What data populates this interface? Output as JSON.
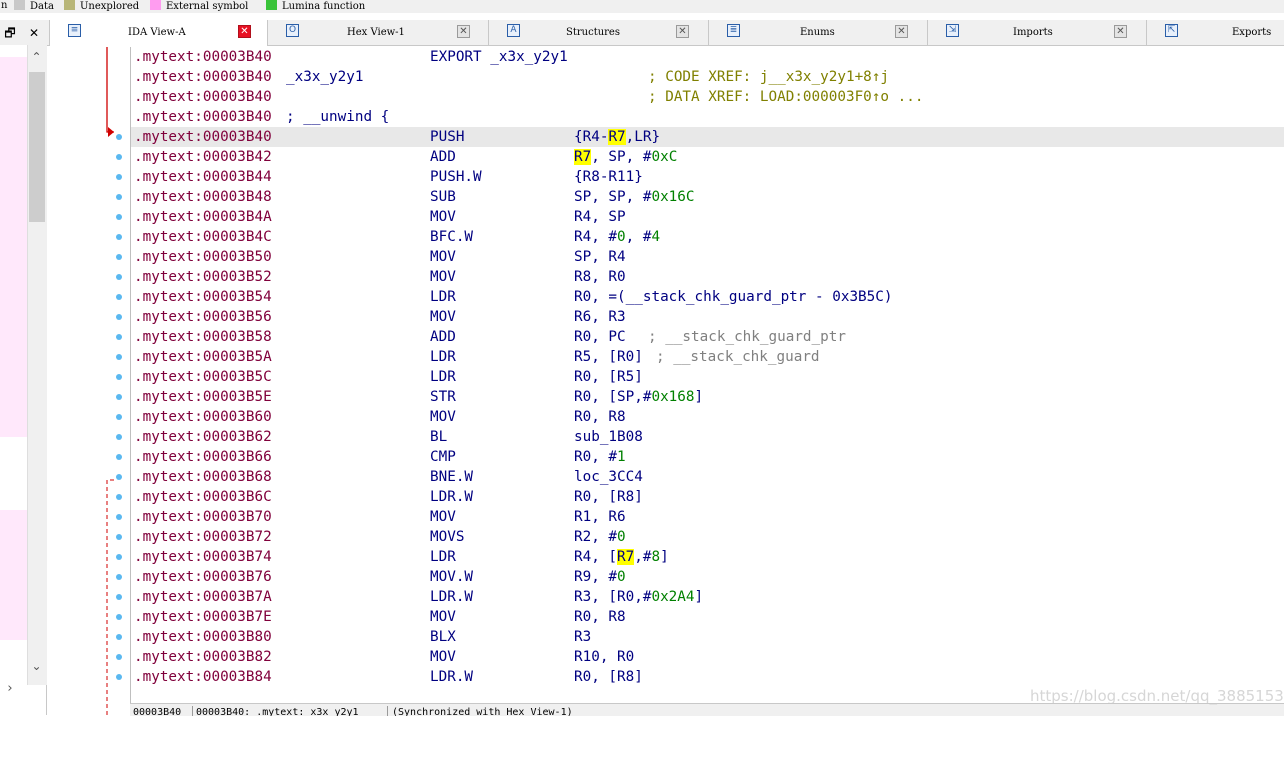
{
  "legend": [
    {
      "label": "n",
      "color": ""
    },
    {
      "label": "Data",
      "color": "#c8c8c8"
    },
    {
      "label": "Unexplored",
      "color": "#b8b678"
    },
    {
      "label": "External symbol",
      "color": "#ff9cf0"
    },
    {
      "label": "Lumina function",
      "color": "#39c339"
    }
  ],
  "left_panel": {
    "restore_glyph": "🗗",
    "close_glyph": "✕",
    "scroll_up": "⌃",
    "scroll_down": "⌄",
    "scroll_right": "›"
  },
  "tabs": [
    {
      "label": "IDA View-A",
      "icon": "ida-view-icon",
      "active": true
    },
    {
      "label": "Hex View-1",
      "icon": "hex-view-icon",
      "active": false
    },
    {
      "label": "Structures",
      "icon": "structures-icon",
      "active": false
    },
    {
      "label": "Enums",
      "icon": "enums-icon",
      "active": false
    },
    {
      "label": "Imports",
      "icon": "imports-icon",
      "active": false
    },
    {
      "label": "Exports",
      "icon": "exports-icon",
      "active": false
    }
  ],
  "close_glyph": "✕",
  "code_lines": [
    {
      "addr": ".mytext:00003B40",
      "mn": "EXPORT _x3x_y2y1"
    },
    {
      "addr": ".mytext:00003B40",
      "label": "_x3x_y2y1",
      "xref": "; CODE XREF: j__x3x_y2y1+8↑j"
    },
    {
      "addr": ".mytext:00003B40",
      "xref": "; DATA XREF: LOAD:000003F0↑o ..."
    },
    {
      "addr": ".mytext:00003B40",
      "label": "; __unwind {"
    },
    {
      "addr": ".mytext:00003B40",
      "mn": "PUSH",
      "op": "{R4-R7,LR}"
    },
    {
      "addr": ".mytext:00003B42",
      "mn": "ADD",
      "op": "R7, SP, #0xC"
    },
    {
      "addr": ".mytext:00003B44",
      "mn": "PUSH.W",
      "op": "{R8-R11}"
    },
    {
      "addr": ".mytext:00003B48",
      "mn": "SUB",
      "op": "SP, SP, #0x16C"
    },
    {
      "addr": ".mytext:00003B4A",
      "mn": "MOV",
      "op": "R4, SP"
    },
    {
      "addr": ".mytext:00003B4C",
      "mn": "BFC.W",
      "op": "R4, #0, #4"
    },
    {
      "addr": ".mytext:00003B50",
      "mn": "MOV",
      "op": "SP, R4"
    },
    {
      "addr": ".mytext:00003B52",
      "mn": "MOV",
      "op": "R8, R0"
    },
    {
      "addr": ".mytext:00003B54",
      "mn": "LDR",
      "op": "R0, =(__stack_chk_guard_ptr - 0x3B5C)"
    },
    {
      "addr": ".mytext:00003B56",
      "mn": "MOV",
      "op": "R6, R3"
    },
    {
      "addr": ".mytext:00003B58",
      "mn": "ADD",
      "op": "R0, PC",
      "cmt": "; __stack_chk_guard_ptr"
    },
    {
      "addr": ".mytext:00003B5A",
      "mn": "LDR",
      "op": "R5, [R0]",
      "cmt": "; __stack_chk_guard"
    },
    {
      "addr": ".mytext:00003B5C",
      "mn": "LDR",
      "op": "R0, [R5]"
    },
    {
      "addr": ".mytext:00003B5E",
      "mn": "STR",
      "op": "R0, [SP,#0x168]"
    },
    {
      "addr": ".mytext:00003B60",
      "mn": "MOV",
      "op": "R0, R8"
    },
    {
      "addr": ".mytext:00003B62",
      "mn": "BL",
      "op": "sub_1B08"
    },
    {
      "addr": ".mytext:00003B66",
      "mn": "CMP",
      "op": "R0, #1"
    },
    {
      "addr": ".mytext:00003B68",
      "mn": "BNE.W",
      "op": "loc_3CC4"
    },
    {
      "addr": ".mytext:00003B6C",
      "mn": "LDR.W",
      "op": "R0, [R8]"
    },
    {
      "addr": ".mytext:00003B70",
      "mn": "MOV",
      "op": "R1, R6"
    },
    {
      "addr": ".mytext:00003B72",
      "mn": "MOVS",
      "op": "R2, #0"
    },
    {
      "addr": ".mytext:00003B74",
      "mn": "LDR",
      "op": "R4, [R7,#8]"
    },
    {
      "addr": ".mytext:00003B76",
      "mn": "MOV.W",
      "op": "R9, #0"
    },
    {
      "addr": ".mytext:00003B7A",
      "mn": "LDR.W",
      "op": "R3, [R0,#0x2A4]"
    },
    {
      "addr": ".mytext:00003B7E",
      "mn": "MOV",
      "op": "R0, R8"
    },
    {
      "addr": ".mytext:00003B80",
      "mn": "BLX",
      "op": "R3"
    },
    {
      "addr": ".mytext:00003B82",
      "mn": "MOV",
      "op": "R10, R0"
    },
    {
      "addr": ".mytext:00003B84",
      "mn": "LDR.W",
      "op": "R0, [R8]"
    }
  ],
  "status": {
    "offset": "00003B40",
    "location": "00003B40: .mytext:_x3x_y2y1",
    "sync": "(Synchronized with Hex View-1)"
  },
  "watermark": "https://blog.csdn.net/qq_38851536"
}
